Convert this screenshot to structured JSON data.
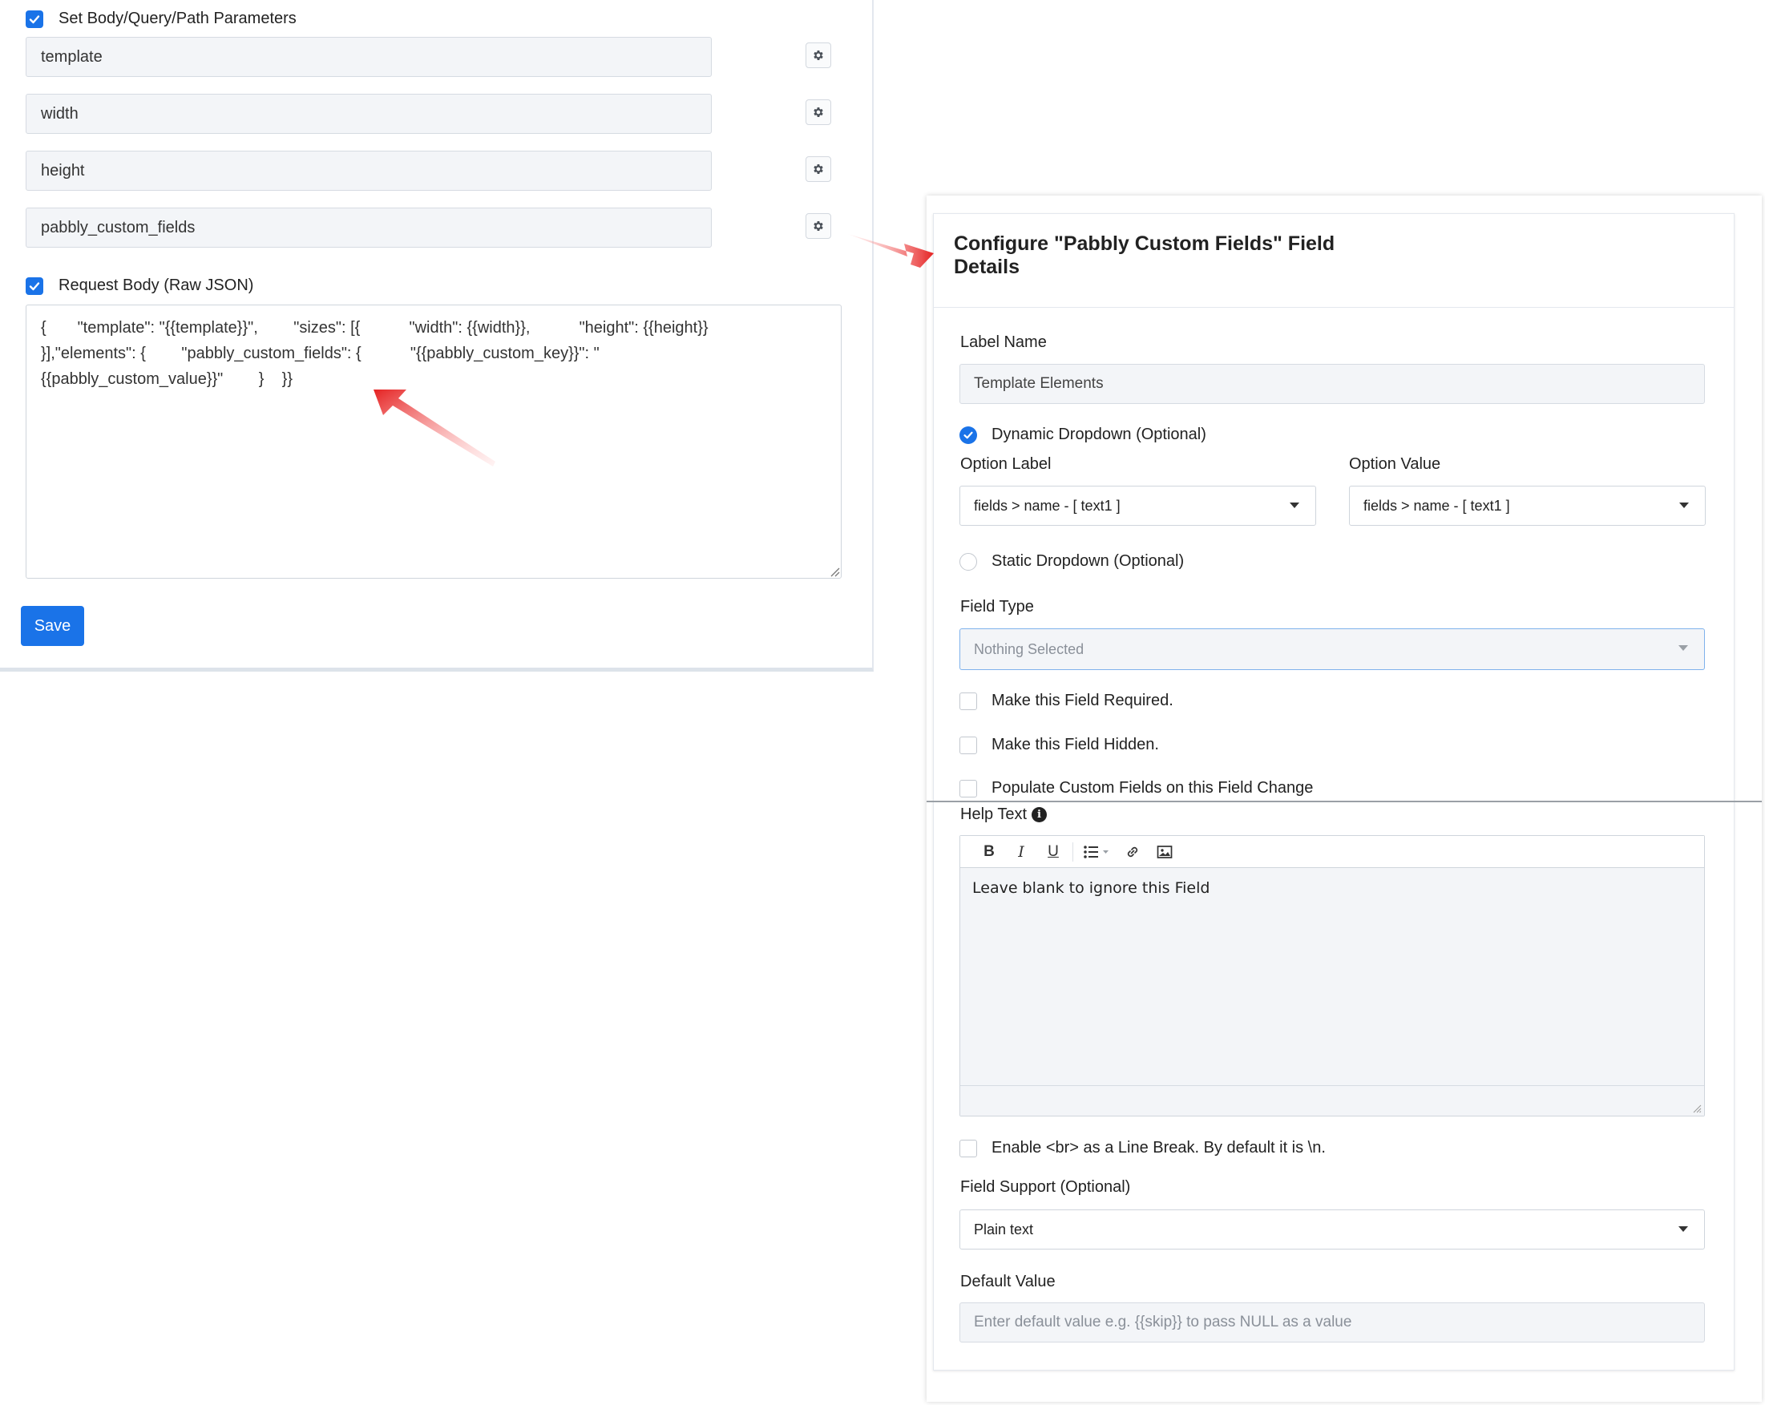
{
  "left": {
    "params_checkbox_label": "Set Body/Query/Path Parameters",
    "params": [
      "template",
      "width",
      "height",
      "pabbly_custom_fields"
    ],
    "request_body_label": "Request Body (Raw JSON)",
    "json_body": "{       \"template\": \"{{template}}\",        \"sizes\": [{           \"width\": {{width}},           \"height\": {{height}}\n}],\"elements\": {        \"pabbly_custom_fields\": {           \"{{pabbly_custom_key}}\": \"\n{{pabbly_custom_value}}\"        }    }}",
    "save_label": "Save"
  },
  "config": {
    "title": "Configure \"Pabbly Custom Fields\" Field Details",
    "label_name_label": "Label Name",
    "label_name_value": "Template Elements",
    "dynamic_dropdown_label": "Dynamic Dropdown (Optional)",
    "option_label_label": "Option Label",
    "option_label_value": "fields > name - [ text1 ]",
    "option_value_label": "Option Value",
    "option_value_value": "fields > name - [ text1 ]",
    "static_dropdown_label": "Static Dropdown (Optional)",
    "field_type_label": "Field Type",
    "field_type_placeholder": "Nothing Selected",
    "required_label": "Make this Field Required.",
    "hidden_label": "Make this Field Hidden.",
    "populate_label": "Populate Custom Fields on this Field Change",
    "help_text_label": "Help Text",
    "help_text_value": "Leave blank to ignore this Field",
    "line_break_label": "Enable <br> as a Line Break. By default it is \\n.",
    "field_support_label": "Field Support (Optional)",
    "field_support_value": "Plain text",
    "default_value_label": "Default Value",
    "default_value_placeholder": "Enter default value e.g. {{skip}} to pass NULL as a value"
  },
  "toolbar": {
    "bold": "B",
    "italic": "I",
    "underline": "U"
  },
  "colors": {
    "accent": "#1a73e8",
    "arrow": "#e52222"
  }
}
